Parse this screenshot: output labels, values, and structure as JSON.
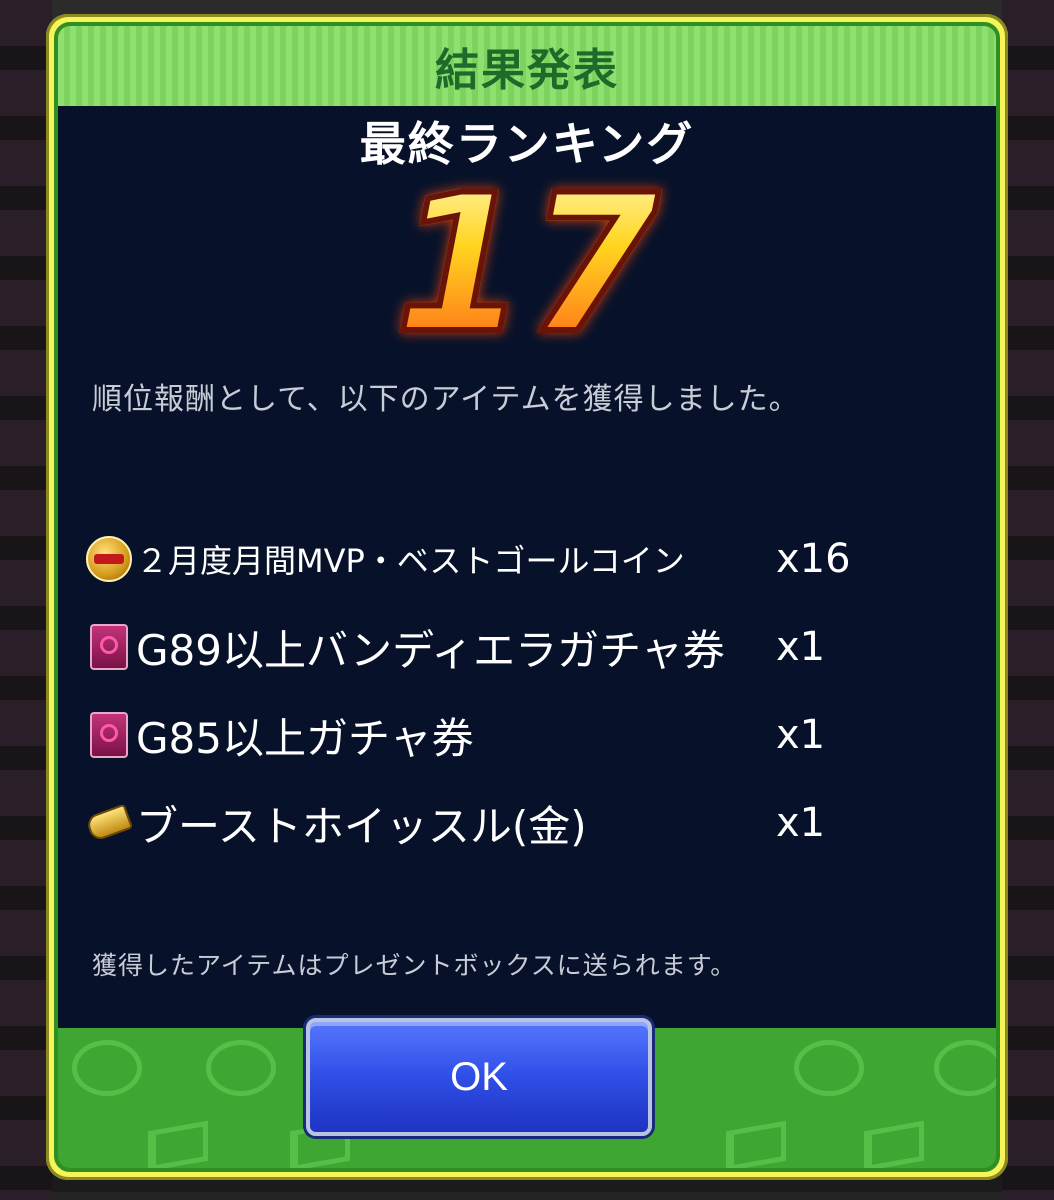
{
  "dialog": {
    "title": "結果発表",
    "rank_heading": "最終ランキング",
    "rank_value": "17",
    "reward_message": "順位報酬として、以下のアイテムを獲得しました。",
    "notice": "獲得したアイテムはプレゼントボックスに送られます。",
    "ok_label": "OK"
  },
  "rewards": [
    {
      "icon": "gotm-coin-icon",
      "name": "２月度月間MVP・ベストゴールコイン",
      "qty": "x16"
    },
    {
      "icon": "bandiera-ticket-icon",
      "name": "G89以上バンディエラガチャ券",
      "qty": "x1"
    },
    {
      "icon": "gacha-ticket-icon",
      "name": "G85以上ガチャ券",
      "qty": "x1"
    },
    {
      "icon": "gold-whistle-icon",
      "name": "ブーストホイッスル(金)",
      "qty": "x1"
    }
  ],
  "colors": {
    "frame": "#f7f45a",
    "header_green": "#8fe070",
    "content_bg": "#07122a",
    "footer_green": "#3fa634",
    "button_blue": "#2f4ee6",
    "rank_gold": "#ffd21a"
  }
}
